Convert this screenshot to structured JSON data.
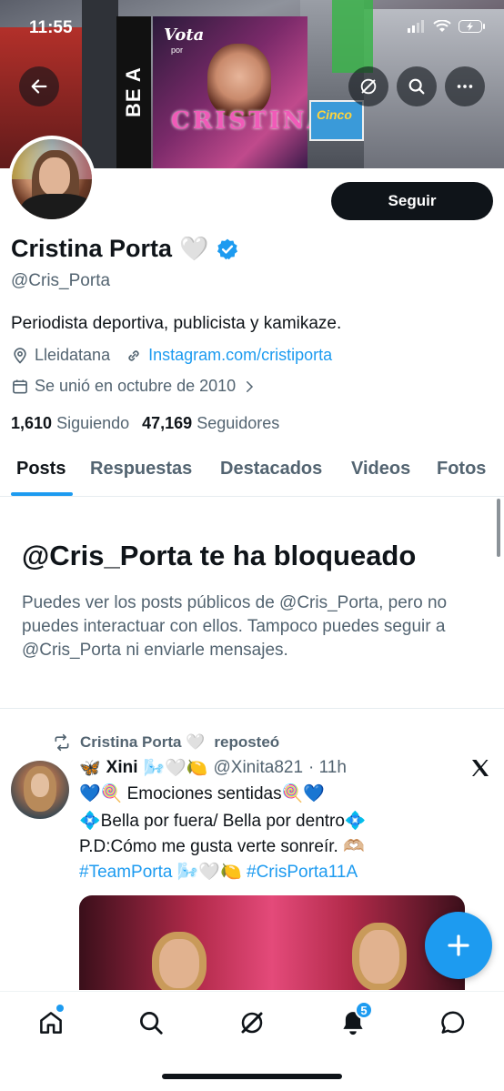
{
  "status_bar": {
    "time": "11:55"
  },
  "banner": {
    "billboard_vota": "Vota",
    "billboard_por": "por",
    "billboard_name": "CRISTINA",
    "side_text": "BE A PIXELSTAR",
    "cinco_text": "Cinco"
  },
  "profile": {
    "follow_label": "Seguir",
    "name": "Cristina Porta",
    "name_emoji": "🤍",
    "handle": "@Cris_Porta",
    "bio": "Periodista deportiva, publicista y kamikaze.",
    "location": "Lleidatana",
    "link": "Instagram.com/cristiporta",
    "joined": "Se unió en octubre de 2010",
    "following_count": "1,610",
    "following_label": "Siguiendo",
    "followers_count": "47,169",
    "followers_label": "Seguidores"
  },
  "tabs": [
    {
      "label": "Posts",
      "active": true
    },
    {
      "label": "Respuestas"
    },
    {
      "label": "Destacados"
    },
    {
      "label": "Videos"
    },
    {
      "label": "Fotos"
    }
  ],
  "blocked": {
    "title": "@Cris_Porta te ha bloqueado",
    "text": "Puedes ver los posts públicos de @Cris_Porta, pero no puedes interactuar con ellos. Tampoco puedes seguir a @Cris_Porta ni enviarle mensajes."
  },
  "post": {
    "repost_name": "Cristina Porta 🤍",
    "repost_label": "reposteó",
    "author_prefix": "🦋",
    "author_name": "Xini",
    "author_emojis": "🌬️🤍🍋",
    "author_handle": "@Xinita821",
    "time": "· 11h",
    "line1": "💙🍭 Emociones sentidas🍭💙",
    "line2": "💠Bella por fuera/ Bella por dentro💠",
    "line3": "P.D:Cómo me gusta verte sonreír. 🫶🏼",
    "hashtag1": "#TeamPorta",
    "hashtag_emojis": "🌬️🤍🍋",
    "hashtag2": "#CrisPorta11A"
  },
  "bottom_nav": {
    "notifications_badge": "5"
  },
  "colors": {
    "accent": "#1d9bf0",
    "text": "#0f1419",
    "muted": "#536471"
  }
}
